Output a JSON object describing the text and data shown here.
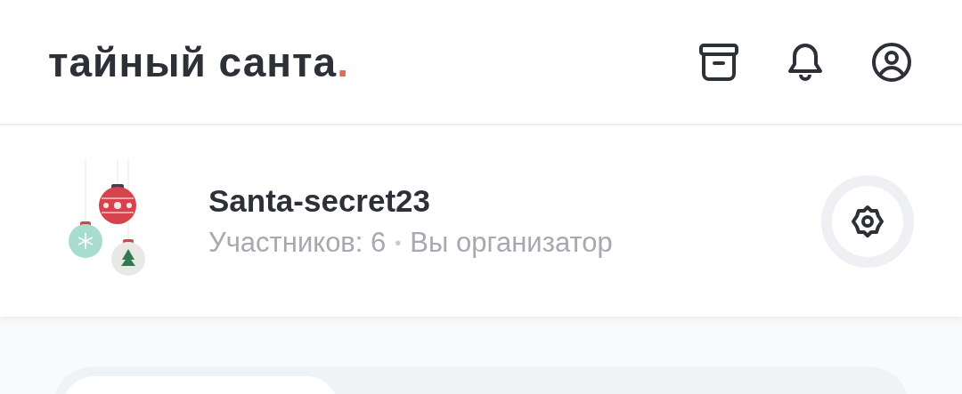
{
  "header": {
    "title": "тайный санта",
    "title_mark": "."
  },
  "group": {
    "name": "Santa-secret23",
    "members": "Участников: 6",
    "separator": "•",
    "role": "Вы организатор"
  }
}
